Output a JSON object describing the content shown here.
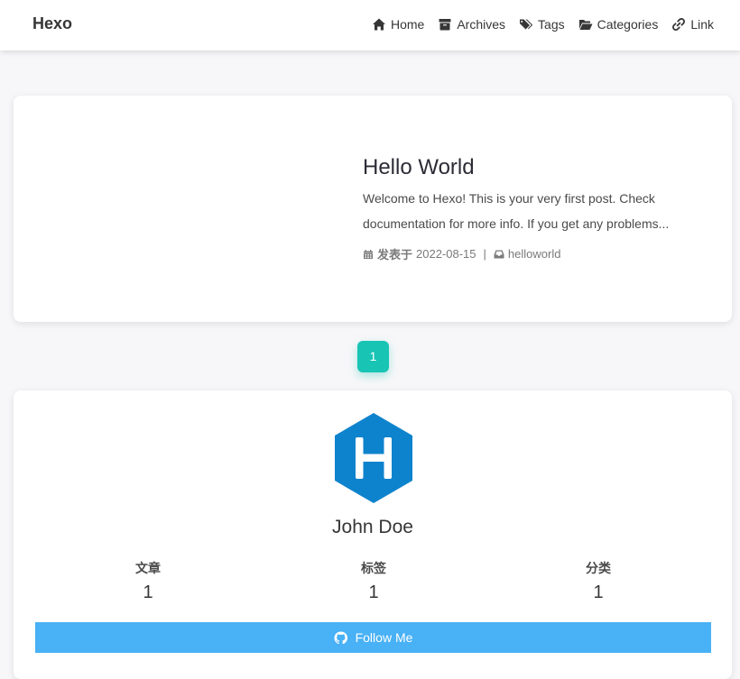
{
  "header": {
    "brand": "Hexo",
    "nav": [
      {
        "label": "Home",
        "icon": "home-icon"
      },
      {
        "label": "Archives",
        "icon": "archive-icon"
      },
      {
        "label": "Tags",
        "icon": "tags-icon"
      },
      {
        "label": "Categories",
        "icon": "folder-open-icon"
      },
      {
        "label": "Link",
        "icon": "link-icon"
      }
    ]
  },
  "post": {
    "title": "Hello World",
    "excerpt": "Welcome to Hexo! This is your very first post. Check documentation for more info. If you get any problems...",
    "date_label": "发表于",
    "date": "2022-08-15",
    "separator": "|",
    "category": "helloworld"
  },
  "pagination": {
    "current": "1"
  },
  "profile": {
    "name": "John Doe",
    "stats": [
      {
        "label": "文章",
        "value": "1"
      },
      {
        "label": "标签",
        "value": "1"
      },
      {
        "label": "分类",
        "value": "1"
      }
    ],
    "follow_label": "Follow Me"
  },
  "colors": {
    "accent_teal": "#18c4b4",
    "follow_blue": "#49b1f5",
    "hexo_blue": "#0e83cd"
  }
}
